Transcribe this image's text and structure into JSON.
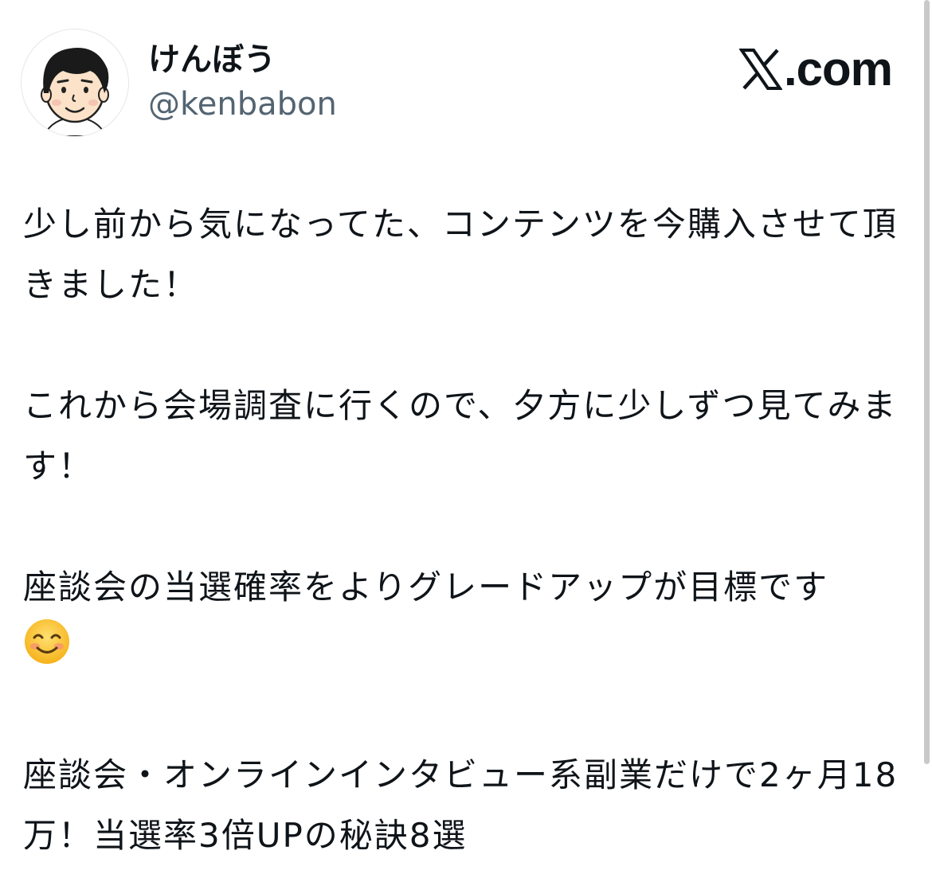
{
  "author": {
    "display_name": "けんぼう",
    "handle": "@kenbabon",
    "avatar_icon": "cartoon-face-avatar"
  },
  "brand": {
    "label": ".com",
    "icon": "x-logo-icon"
  },
  "tweet": {
    "line1": "少し前から気になってた、コンテンツを今購入させて頂きました！",
    "line2": "これから会場調査に行くので、夕方に少しずつ見てみます！",
    "line3": "座談会の当選確率をよりグレードアップが目標です",
    "line3_emoji": "smiling-face-emoji",
    "line4": "座談会・オンラインインタビュー系副業だけで2ヶ月18万！当選率3倍UPの秘訣8選"
  },
  "colors": {
    "text": "#0f1419",
    "handle": "#536471",
    "background": "#ffffff"
  }
}
